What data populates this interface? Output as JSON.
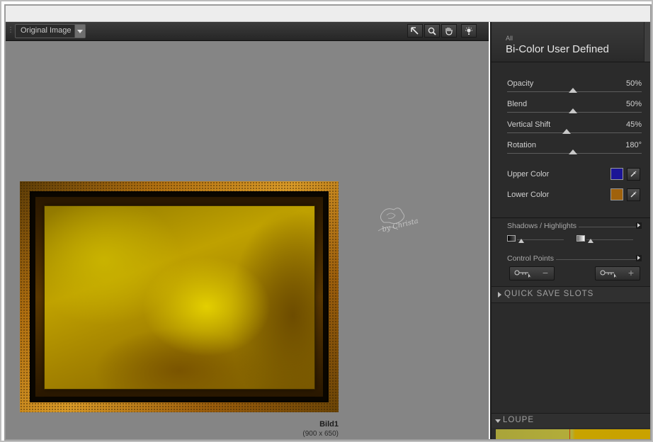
{
  "toolbar": {
    "view_select": "Original Image",
    "tools": [
      {
        "name": "arrow-tool-icon"
      },
      {
        "name": "zoom-tool-icon"
      },
      {
        "name": "hand-tool-icon"
      },
      {
        "name": "light-tool-icon"
      }
    ]
  },
  "canvas": {
    "image_name": "Bild1",
    "image_size": "(900 x 650)",
    "watermark_text": "by Christa"
  },
  "panel": {
    "breadcrumb": "All",
    "filter_title": "Bi-Color User Defined",
    "sliders": [
      {
        "label": "Opacity",
        "value": "50%",
        "level": 0.5
      },
      {
        "label": "Blend",
        "value": "50%",
        "level": 0.5
      },
      {
        "label": "Vertical Shift",
        "value": "45%",
        "level": 0.45
      },
      {
        "label": "Rotation",
        "value": "180°",
        "level": 0.5
      }
    ],
    "colors": [
      {
        "label": "Upper Color",
        "hex": "#1b1596"
      },
      {
        "label": "Lower Color",
        "hex": "#a0620c"
      }
    ],
    "shadows_highlights": "Shadows / Highlights",
    "control_points": "Control Points",
    "quick_save": "QUICK SAVE SLOTS",
    "loupe": "LOUPE"
  }
}
